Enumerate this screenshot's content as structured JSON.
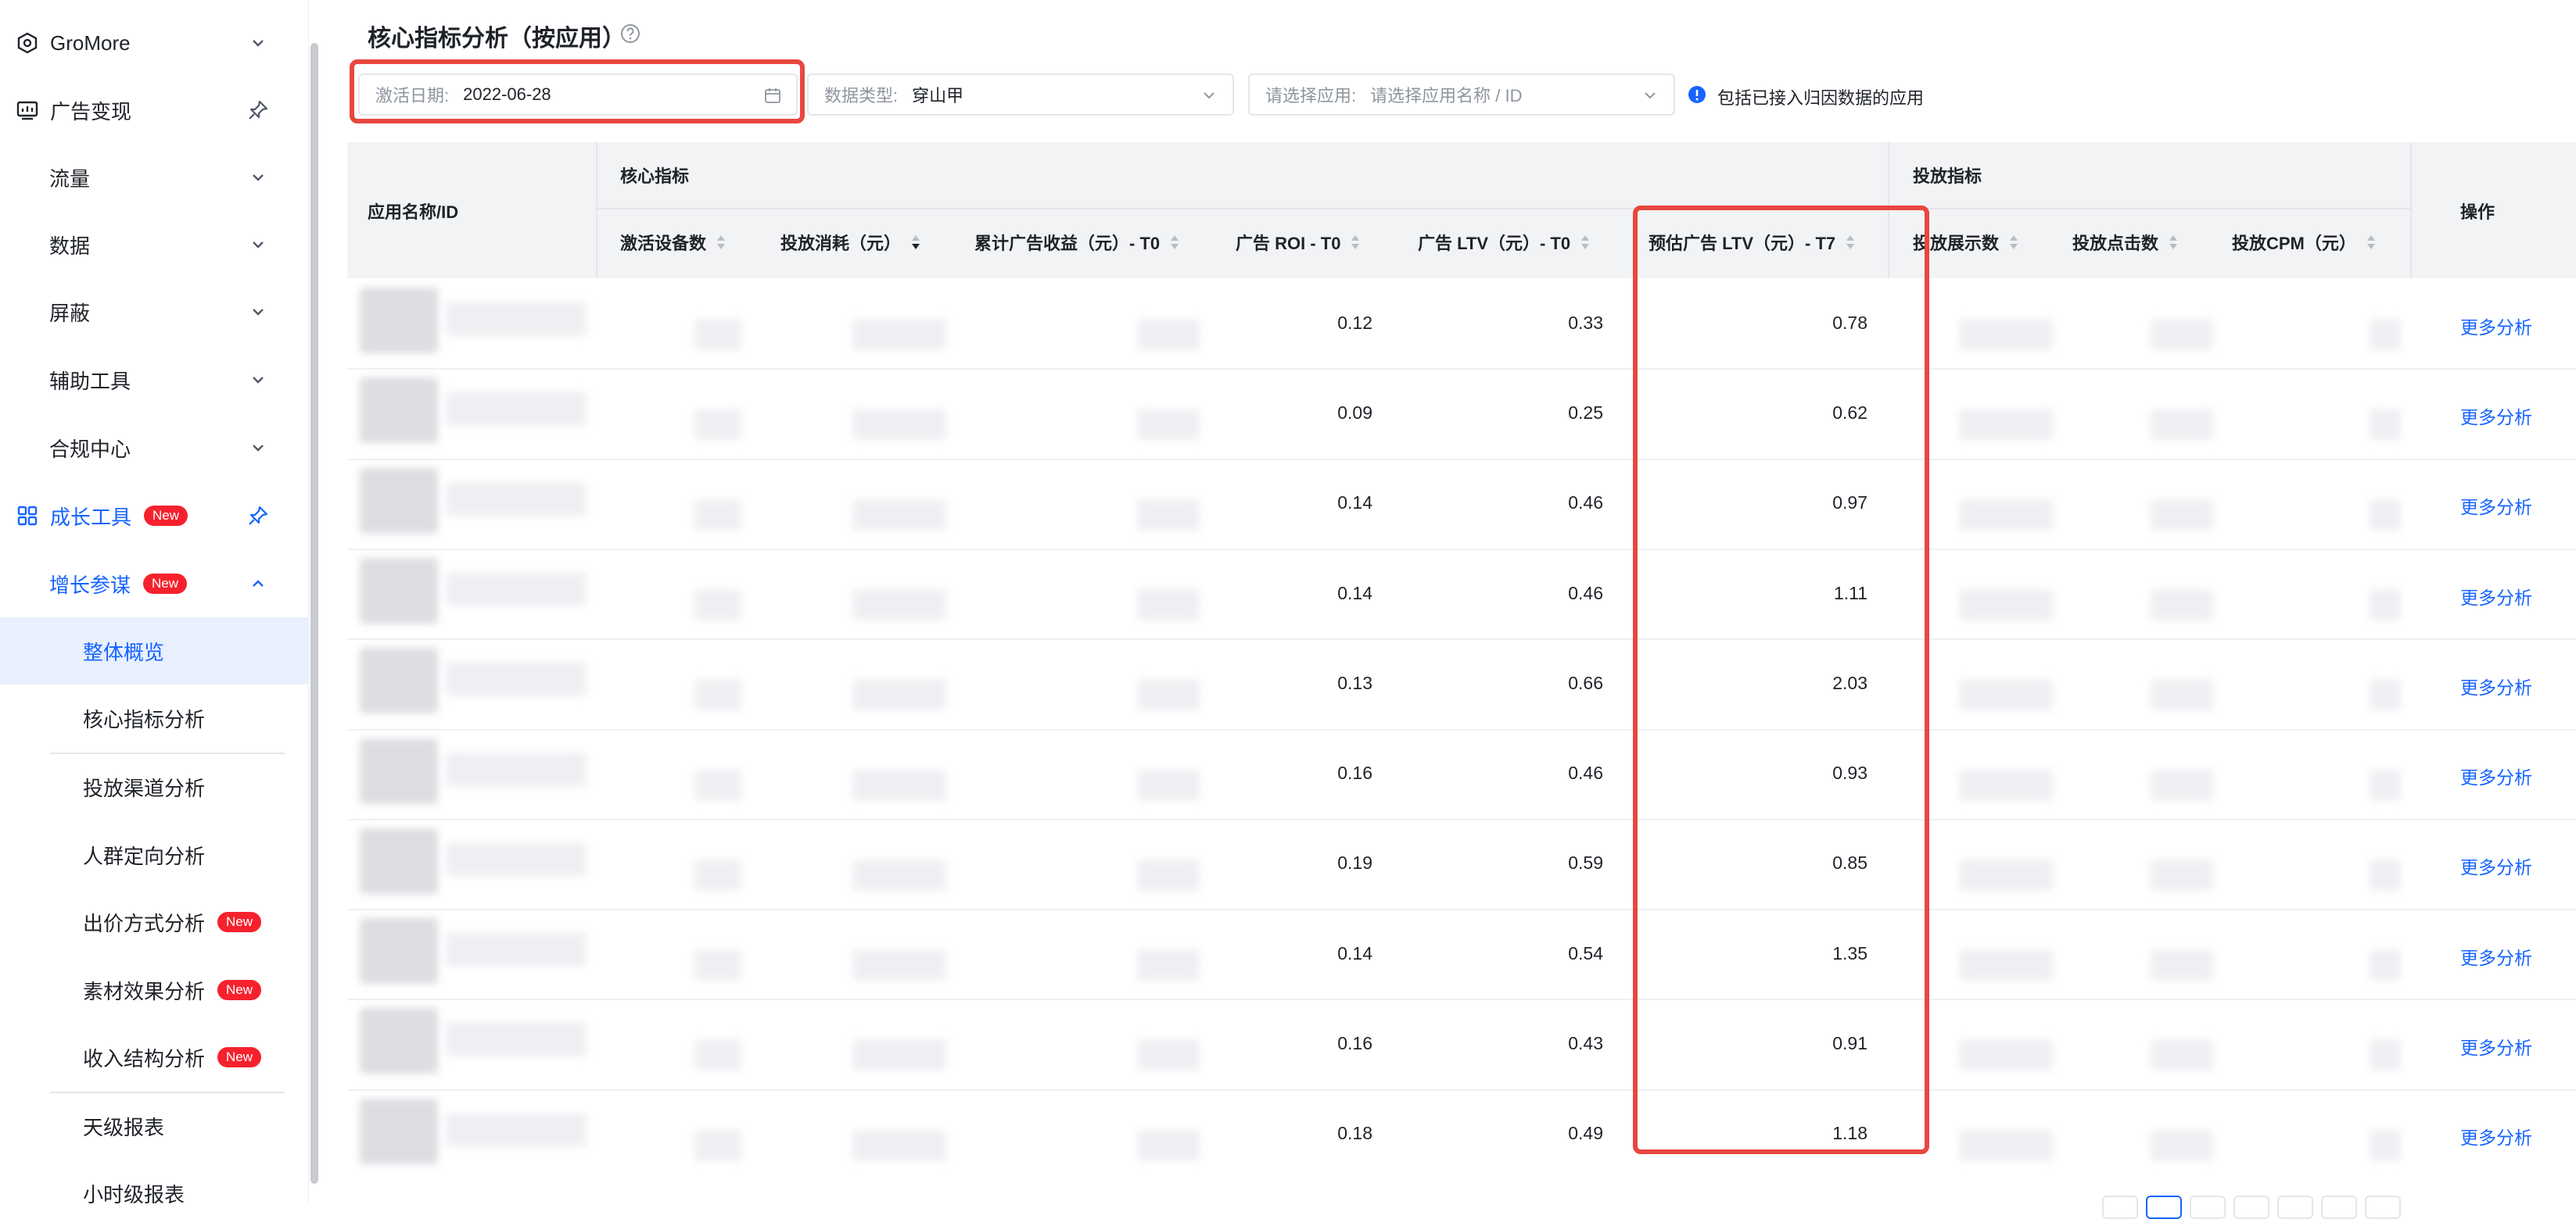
{
  "sidebar": {
    "items": [
      {
        "label": "GroMore",
        "icon": "cube-icon",
        "trail": "chevron-down-icon"
      },
      {
        "label": "广告变现",
        "icon": "chart-monitor-icon",
        "trail": "pin-icon"
      },
      {
        "label": "流量",
        "trail": "chevron-down-icon"
      },
      {
        "label": "数据",
        "trail": "chevron-down-icon"
      },
      {
        "label": "屏蔽",
        "trail": "chevron-down-icon"
      },
      {
        "label": "辅助工具",
        "trail": "chevron-down-icon"
      },
      {
        "label": "合规中心",
        "trail": "chevron-down-icon"
      },
      {
        "label": "成长工具",
        "icon": "grid-icon",
        "badge": "New",
        "trail": "pin-icon"
      },
      {
        "label": "增长参谋",
        "badge": "New",
        "trail": "chevron-up-icon"
      },
      {
        "label": "整体概览"
      },
      {
        "label": "核心指标分析"
      },
      {
        "label": "投放渠道分析"
      },
      {
        "label": "人群定向分析"
      },
      {
        "label": "出价方式分析",
        "badge": "New"
      },
      {
        "label": "素材效果分析",
        "badge": "New"
      },
      {
        "label": "收入结构分析",
        "badge": "New"
      },
      {
        "label": "天级报表"
      },
      {
        "label": "小时级报表"
      }
    ]
  },
  "page": {
    "title": "核心指标分析（按应用）"
  },
  "filters": {
    "date_label": "激活日期:",
    "date_value": "2022-06-28",
    "type_label": "数据类型:",
    "type_value": "穿山甲",
    "app_label": "请选择应用:",
    "app_placeholder": "请选择应用名称 / ID",
    "info_text": "包括已接入归因数据的应用"
  },
  "table": {
    "app_header": "应用名称/ID",
    "group_core": "核心指标",
    "group_delivery": "投放指标",
    "op_header": "操作",
    "columns": [
      "激活设备数",
      "投放消耗（元）",
      "累计广告收益（元）- T0",
      "广告 ROI - T0",
      "广告 LTV（元）- T0",
      "预估广告 LTV（元）- T7",
      "投放展示数",
      "投放点击数",
      "投放CPM（元）"
    ],
    "rows": [
      {
        "roi": "0.12",
        "ltv_t0": "0.33",
        "ltv_t7": "0.78",
        "action": "更多分析"
      },
      {
        "roi": "0.09",
        "ltv_t0": "0.25",
        "ltv_t7": "0.62",
        "action": "更多分析"
      },
      {
        "roi": "0.14",
        "ltv_t0": "0.46",
        "ltv_t7": "0.97",
        "action": "更多分析"
      },
      {
        "roi": "0.14",
        "ltv_t0": "0.46",
        "ltv_t7": "1.11",
        "action": "更多分析"
      },
      {
        "roi": "0.13",
        "ltv_t0": "0.66",
        "ltv_t7": "2.03",
        "action": "更多分析"
      },
      {
        "roi": "0.16",
        "ltv_t0": "0.46",
        "ltv_t7": "0.93",
        "action": "更多分析"
      },
      {
        "roi": "0.19",
        "ltv_t0": "0.59",
        "ltv_t7": "0.85",
        "action": "更多分析"
      },
      {
        "roi": "0.14",
        "ltv_t0": "0.54",
        "ltv_t7": "1.35",
        "action": "更多分析"
      },
      {
        "roi": "0.16",
        "ltv_t0": "0.43",
        "ltv_t7": "0.91",
        "action": "更多分析"
      },
      {
        "roi": "0.18",
        "ltv_t0": "0.49",
        "ltv_t7": "1.18",
        "action": "更多分析"
      }
    ]
  },
  "colors": {
    "accent": "#1664ff",
    "highlight": "#e8473f",
    "badge": "#f5222d"
  }
}
